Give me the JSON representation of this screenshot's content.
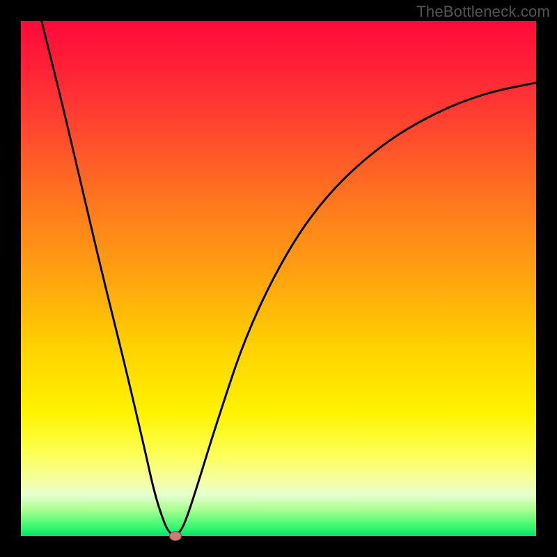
{
  "watermark": "TheBottleneck.com",
  "chart_data": {
    "type": "line",
    "title": "",
    "xlabel": "",
    "ylabel": "",
    "xlim": [
      0,
      100
    ],
    "ylim": [
      0,
      100
    ],
    "series": [
      {
        "name": "curve",
        "x": [
          4,
          8,
          12,
          16,
          20,
          24,
          26,
          28,
          29,
          30,
          31,
          32,
          34,
          38,
          44,
          52,
          60,
          70,
          80,
          90,
          100
        ],
        "y": [
          100,
          84,
          67,
          50,
          34,
          17,
          8,
          2,
          0.5,
          0,
          1,
          3,
          9,
          22,
          40,
          56,
          67,
          76,
          82,
          86,
          88
        ]
      }
    ],
    "marker": {
      "x": 30,
      "y": 0
    },
    "background_gradient": {
      "top": "#ff0a3a",
      "bottom": "#00e36e"
    }
  }
}
